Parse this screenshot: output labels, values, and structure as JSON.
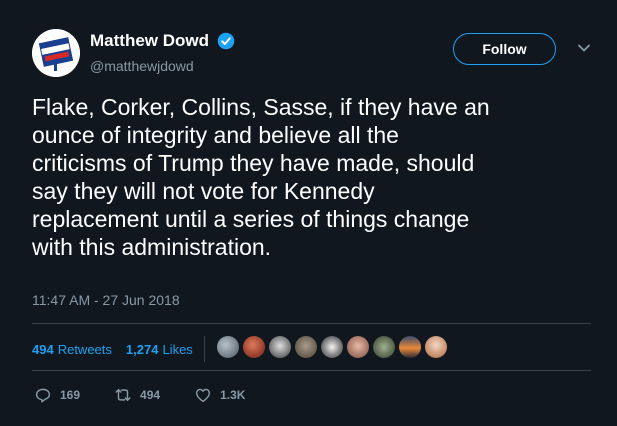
{
  "user": {
    "display_name": "Matthew Dowd",
    "handle": "@matthewjdowd",
    "verified": true
  },
  "follow_label": "Follow",
  "tweet": {
    "lines": [
      "Flake, Corker, Collins, Sasse, if they have an",
      "ounce of integrity and believe all the",
      "criticisms of Trump they have made, should",
      "say they will not vote for Kennedy",
      "replacement until a series of things change",
      "with this administration."
    ],
    "timestamp": "11:47 AM - 27 Jun 2018"
  },
  "stats": {
    "retweets_count": "494",
    "retweets_label": "Retweets",
    "likes_count": "1,274",
    "likes_label": "Likes"
  },
  "likers": [
    {
      "name": "liker-1"
    },
    {
      "name": "liker-2"
    },
    {
      "name": "liker-3"
    },
    {
      "name": "liker-4"
    },
    {
      "name": "liker-5"
    },
    {
      "name": "liker-6"
    },
    {
      "name": "liker-7"
    },
    {
      "name": "liker-8"
    },
    {
      "name": "liker-9"
    },
    {
      "name": "liker-10"
    }
  ],
  "actions": {
    "reply_count": "169",
    "retweet_count": "494",
    "like_count": "1.3K"
  },
  "colors": {
    "background": "#10171e",
    "accent": "#1da1f2",
    "secondary_text": "#8899a6",
    "divider": "#38444d"
  },
  "icons": {
    "verified": "verified-badge-icon",
    "caret": "chevron-down-icon",
    "reply": "reply-icon",
    "retweet": "retweet-icon",
    "like": "heart-icon"
  }
}
